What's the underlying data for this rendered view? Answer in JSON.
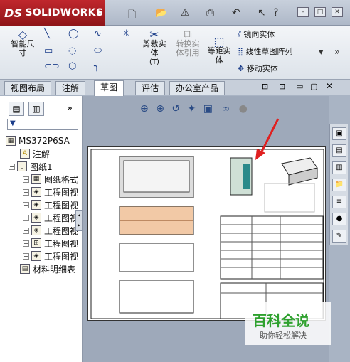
{
  "app": {
    "brand": "SOLIDWORKS",
    "brand_prefix": "DS"
  },
  "ribbon": {
    "smart_dim": "智能尺寸",
    "trim": "剪裁实体",
    "trim_code": "(T)",
    "convert": "转换实体引用",
    "offset": "等距实体",
    "mirror": "镜向实体",
    "linear_pattern": "线性草图阵列",
    "move": "移动实体"
  },
  "tabs": [
    "视图布局",
    "注解",
    "草图",
    "评估",
    "办公室产品"
  ],
  "active_tab": "草图",
  "tree": {
    "root": "MS372P6SA",
    "annotations": "注解",
    "sheet": "图纸1",
    "items": [
      "图纸格式",
      "工程图视",
      "工程图视",
      "工程图视",
      "工程图视",
      "工程图视",
      "工程图视"
    ],
    "bom": "材料明细表"
  },
  "watermark": {
    "title": "百科全说",
    "subtitle": "助你轻松解决"
  },
  "colors": {
    "accent": "#c0272d",
    "arrow": "#e02020",
    "watermark": "#2ea12e"
  }
}
